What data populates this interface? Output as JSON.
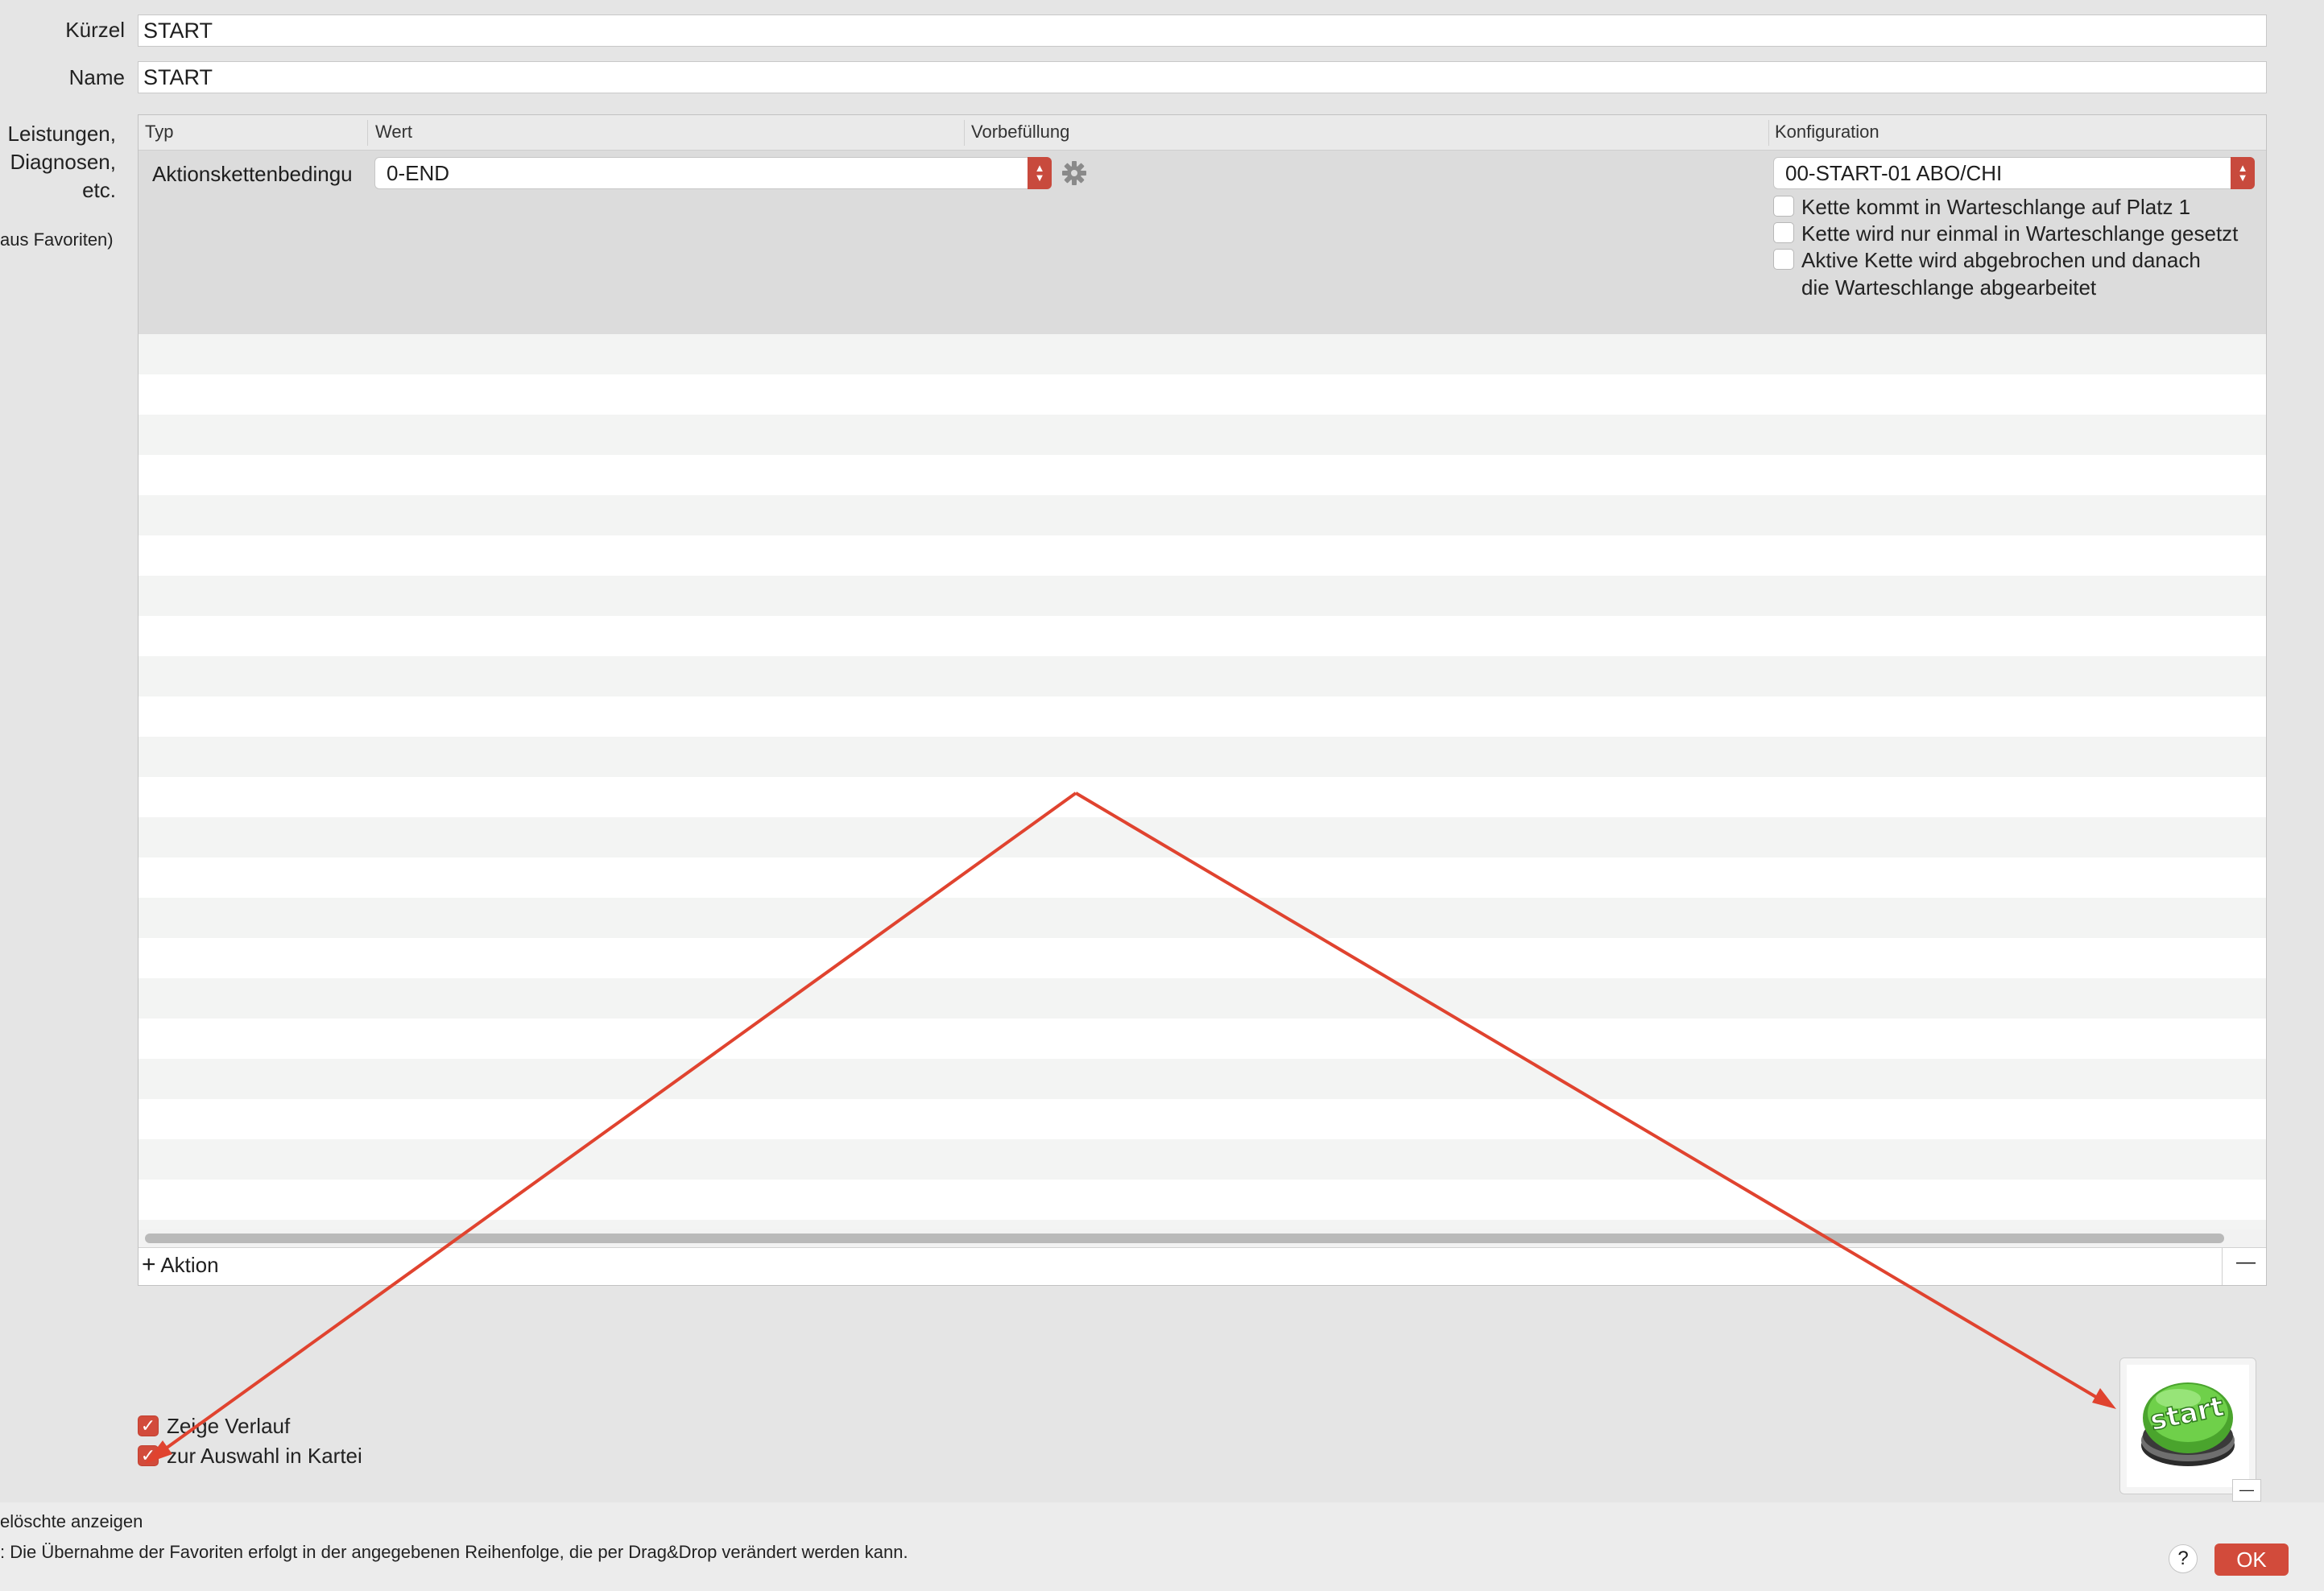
{
  "form": {
    "kuerzel_label": "Kürzel",
    "kuerzel_value": "START",
    "name_label": "Name",
    "name_value": "START",
    "leistungen_label_line1": "Leistungen,",
    "leistungen_label_line2": "Diagnosen,",
    "leistungen_label_line3": "etc.",
    "favoriten_note": "aus Favoriten)"
  },
  "table": {
    "columns": [
      "Typ",
      "Wert",
      "Vorbefüllung",
      "Konfiguration"
    ],
    "row": {
      "typ": "Aktionskettenbedingu",
      "wert": "0-END",
      "konfiguration": "00-START-01 ABO/CHI",
      "options": [
        {
          "label": "Kette kommt in Warteschlange auf Platz 1",
          "checked": false
        },
        {
          "label": "Kette wird nur einmal in Warteschlange gesetzt",
          "checked": false
        },
        {
          "label": "Aktive Kette wird abgebrochen und danach",
          "checked": false
        }
      ],
      "option3_line2": "die Warteschlange abgearbeitet"
    },
    "add_action": "Aktion",
    "add_symbol": "+",
    "remove_symbol": "—"
  },
  "checks": {
    "zeige_verlauf": "Zeige Verlauf",
    "zur_auswahl": "zur Auswahl in Kartei",
    "checkmark": "✓"
  },
  "image_well": {
    "button_text": "start",
    "remove_symbol": "—"
  },
  "footer": {
    "geloeschte": "elöschte anzeigen",
    "hinweis": ": Die Übernahme der Favoriten erfolgt in der angegebenen Reihenfolge, die per Drag&Drop verändert werden kann.",
    "help": "?",
    "ok": "OK"
  },
  "colors": {
    "accent": "#d24b3b",
    "annotation_arrow": "#e0432f",
    "start_button_green": "#5cc13a"
  },
  "icons": {
    "settings": "gear-icon",
    "stepper": "chevron-updown-icon"
  }
}
